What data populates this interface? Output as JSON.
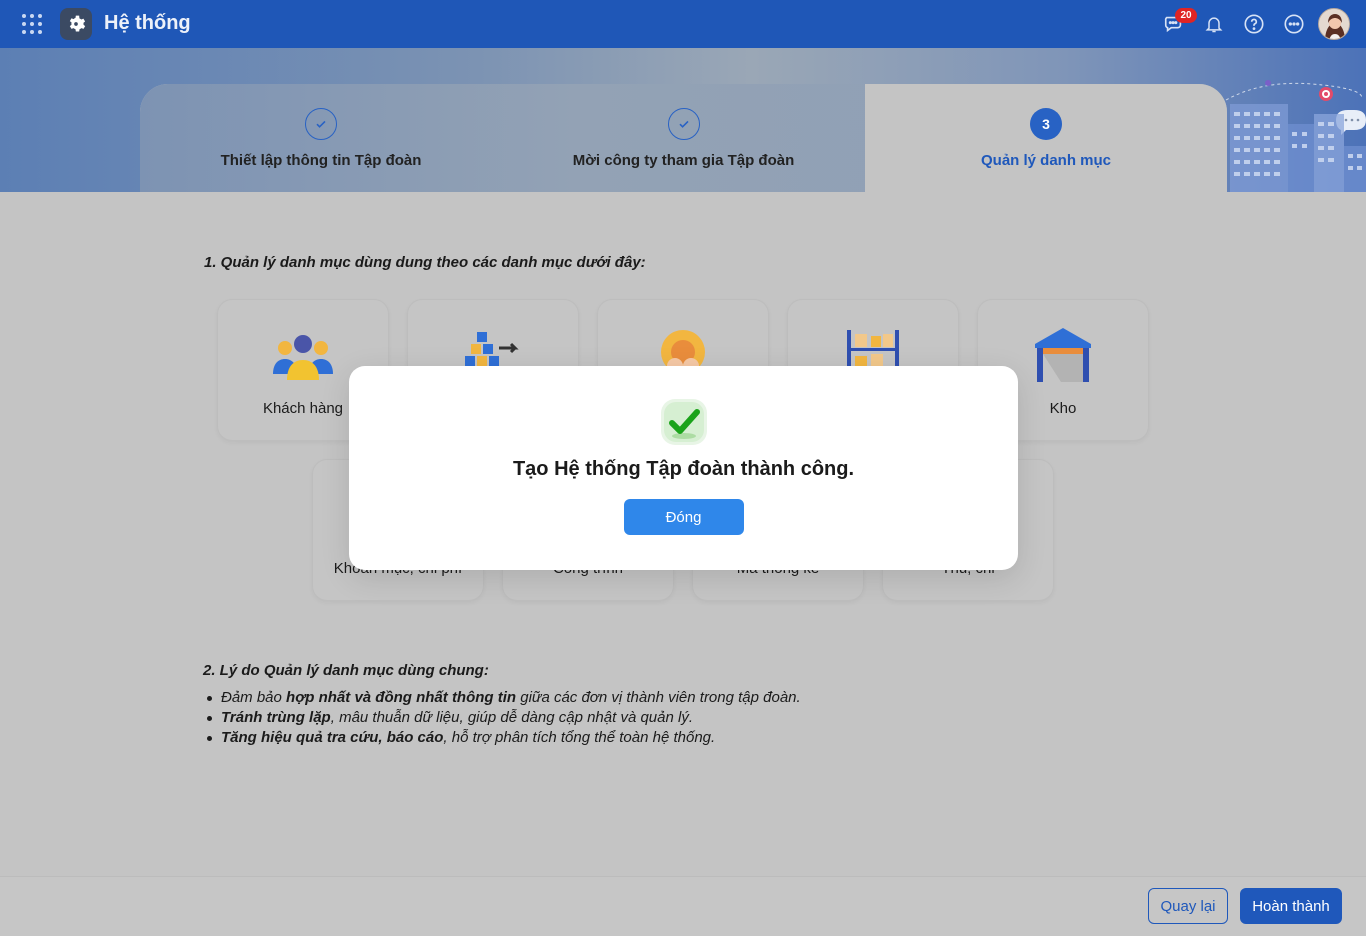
{
  "topbar": {
    "app_title": "Hệ thống",
    "notification_count": "20",
    "icons": [
      "apps-grid-icon",
      "settings-gear-icon",
      "chat-icon",
      "bell-icon",
      "help-icon",
      "more-icon",
      "avatar"
    ]
  },
  "steps": [
    {
      "label": "Thiết lập thông tin Tập đoàn",
      "state": "done"
    },
    {
      "label": "Mời công ty tham gia Tập đoàn",
      "state": "done"
    },
    {
      "number": "3",
      "label": "Quản lý danh mục",
      "state": "active"
    }
  ],
  "section1": {
    "title": "1. Quản lý danh mục dùng dung theo các danh mục dưới đây:",
    "tiles_row1": [
      "Khách hàng",
      "",
      "",
      "",
      "Kho"
    ],
    "tiles_row2": [
      "Khoản mục, chi phí",
      "Công trình",
      "Mã thống kê",
      "Thu, chi"
    ]
  },
  "section2": {
    "title": "2. Lý do Quản lý danh mục dùng chung:",
    "reasons": [
      {
        "pre": "Đảm bảo ",
        "bold": "hợp nhất và đồng nhất thông tin",
        "post": " giữa các đơn vị thành viên trong tập đoàn."
      },
      {
        "pre": "",
        "bold": "Tránh trùng lặp",
        "post": ", mâu thuẫn dữ liệu, giúp dễ dàng cập nhật và quản lý."
      },
      {
        "pre": "",
        "bold": "Tăng hiệu quả tra cứu, báo cáo",
        "post": ", hỗ trợ phân tích tổng thể toàn hệ thống."
      }
    ]
  },
  "footer": {
    "back_label": "Quay lại",
    "finish_label": "Hoàn thành"
  },
  "modal": {
    "message": "Tạo Hệ thống Tập đoàn thành công.",
    "close_label": "Đóng"
  },
  "colors": {
    "primary": "#1f58bb",
    "modal_button": "#2f87ea",
    "badge": "#e02424",
    "success": "#2fbf28"
  }
}
